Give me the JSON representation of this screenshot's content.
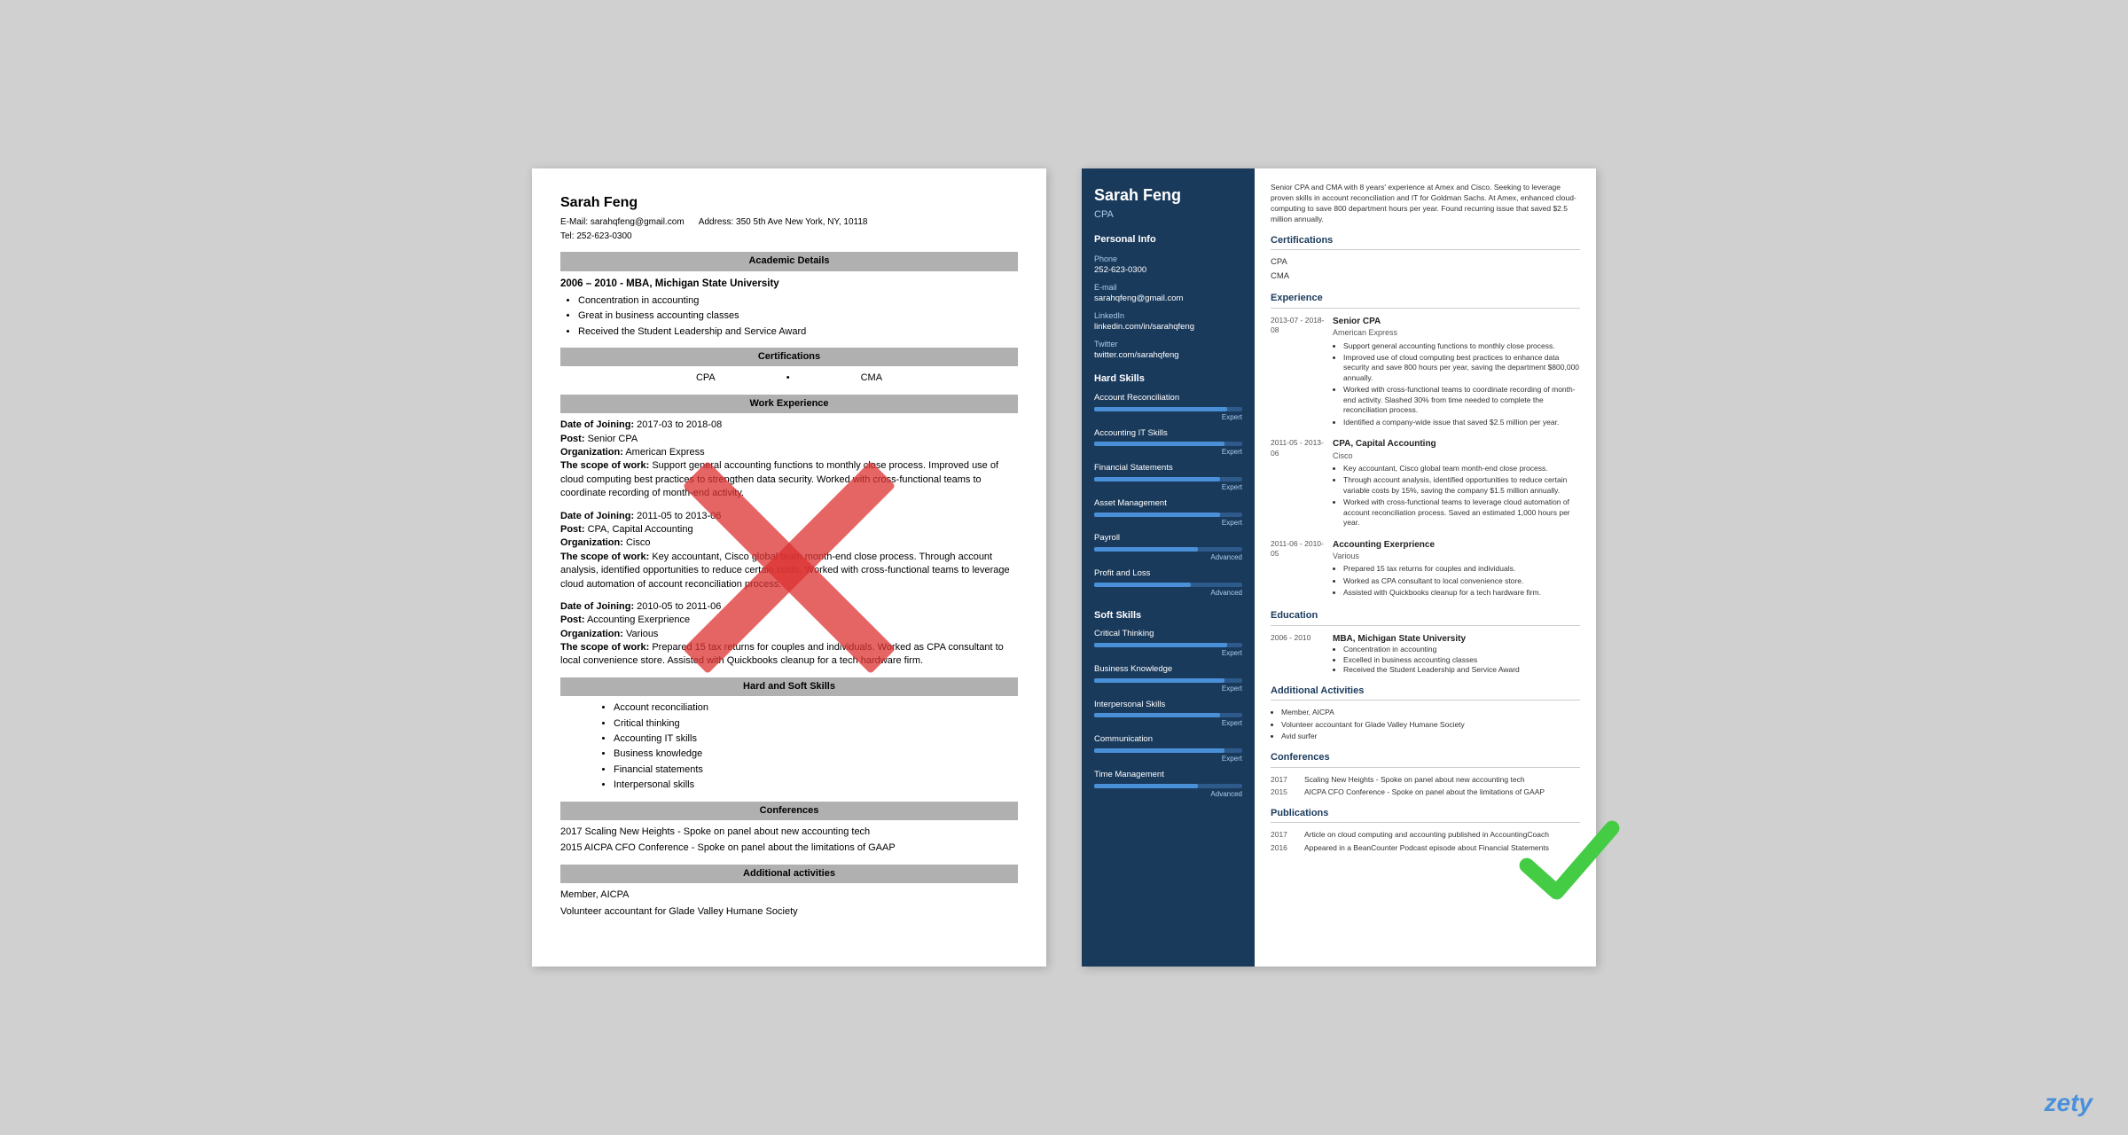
{
  "left_resume": {
    "name": "Sarah Feng",
    "email_label": "E-Mail:",
    "email": "sarahqfeng@gmail.com",
    "address_label": "Address:",
    "address": "350 5th Ave New York, NY, 10118",
    "tel_label": "Tel:",
    "tel": "252-623-0300",
    "sections": {
      "academic": "Academic Details",
      "certifications": "Certifications",
      "work_experience": "Work Experience",
      "hard_soft_skills": "Hard and Soft Skills",
      "conferences": "Conferences",
      "additional": "Additional activities"
    },
    "academic": {
      "dates": "2006 – 2010 - MBA, Michigan State University",
      "bullets": [
        "Concentration in accounting",
        "Great in business accounting classes",
        "Received the Student Leadership and Service Award"
      ]
    },
    "certifications": [
      "CPA",
      "CMA"
    ],
    "work_entries": [
      {
        "date_label": "Date of Joining:",
        "dates": "2017-03 to 2018-08",
        "post_label": "Post:",
        "post": "Senior CPA",
        "org_label": "Organization:",
        "org": "American Express",
        "scope_label": "The scope of work:",
        "scope": "Support general accounting functions to monthly close process. Improved use of cloud computing best practices to strengthen data security. Worked with cross-functional teams to coordinate recording of month-end activity."
      },
      {
        "date_label": "Date of Joining:",
        "dates": "2011-05 to 2013-06",
        "post_label": "Post:",
        "post": "CPA, Capital Accounting",
        "org_label": "Organization:",
        "org": "Cisco",
        "scope_label": "The scope of work:",
        "scope": "Key accountant, Cisco global team month-end close process. Through account analysis, identified opportunities to reduce certain costs. Worked with cross-functional teams to leverage cloud automation of account reconciliation process."
      },
      {
        "date_label": "Date of Joining:",
        "dates": "2010-05 to 2011-06",
        "post_label": "Post:",
        "post": "Accounting Exerprience",
        "org_label": "Organization:",
        "org": "Various",
        "scope_label": "The scope of work:",
        "scope": "Prepared 15 tax returns for couples and individuals. Worked as CPA consultant to local convenience store. Assisted with Quickbooks cleanup for a tech hardware firm."
      }
    ],
    "skills": [
      "Account reconciliation",
      "Critical thinking",
      "Accounting IT skills",
      "Business knowledge",
      "Financial statements",
      "Interpersonal skills"
    ],
    "conferences": [
      "2017 Scaling New Heights - Spoke on panel about new accounting tech",
      "2015 AICPA CFO Conference - Spoke on panel about the limitations of GAAP"
    ],
    "additional": [
      "Member, AICPA",
      "Volunteer accountant for Glade Valley Humane Society"
    ]
  },
  "right_resume": {
    "name": "Sarah Feng",
    "title": "CPA",
    "summary": "Senior CPA and CMA with 8 years' experience at Amex and Cisco. Seeking to leverage proven skills in account reconciliation and IT for Goldman Sachs. At Amex, enhanced cloud-computing to save 800 department hours per year. Found recurring issue that saved $2.5 million annually.",
    "personal_info": {
      "section_title": "Personal Info",
      "phone_label": "Phone",
      "phone": "252-623-0300",
      "email_label": "E-mail",
      "email": "sarahqfeng@gmail.com",
      "linkedin_label": "LinkedIn",
      "linkedin": "linkedin.com/in/sarahqfeng",
      "twitter_label": "Twitter",
      "twitter": "twitter.com/sarahqfeng"
    },
    "hard_skills": {
      "section_title": "Hard Skills",
      "items": [
        {
          "name": "Account Reconciliation",
          "level": "Expert",
          "pct": 90
        },
        {
          "name": "Accounting IT Skills",
          "level": "Expert",
          "pct": 88
        },
        {
          "name": "Financial Statements",
          "level": "Expert",
          "pct": 85
        },
        {
          "name": "Asset Management",
          "level": "Expert",
          "pct": 85
        },
        {
          "name": "Payroll",
          "level": "Advanced",
          "pct": 70
        },
        {
          "name": "Profit and Loss",
          "level": "Advanced",
          "pct": 65
        }
      ]
    },
    "soft_skills": {
      "section_title": "Soft Skills",
      "items": [
        {
          "name": "Critical Thinking",
          "level": "Expert",
          "pct": 90
        },
        {
          "name": "Business Knowledge",
          "level": "Expert",
          "pct": 88
        },
        {
          "name": "Interpersonal Skills",
          "level": "Expert",
          "pct": 85
        },
        {
          "name": "Communication",
          "level": "Expert",
          "pct": 88
        },
        {
          "name": "Time Management",
          "level": "Advanced",
          "pct": 70
        }
      ]
    },
    "certifications": {
      "section_title": "Certifications",
      "items": [
        "CPA",
        "CMA"
      ]
    },
    "experience": {
      "section_title": "Experience",
      "entries": [
        {
          "dates": "2013-07 - 2018-08",
          "title": "Senior CPA",
          "company": "American Express",
          "bullets": [
            "Support general accounting functions to monthly close process.",
            "Improved use of cloud computing best practices to enhance data security and save 800 hours per year, saving the department $800,000 annually.",
            "Worked with cross-functional teams to coordinate recording of month-end activity. Slashed 30% from time needed to complete the reconciliation process.",
            "Identified a company-wide issue that saved $2.5 million per year."
          ]
        },
        {
          "dates": "2011-05 - 2013-06",
          "title": "CPA, Capital Accounting",
          "company": "Cisco",
          "bullets": [
            "Key accountant, Cisco global team month-end close process.",
            "Through account analysis, identified opportunities to reduce certain variable costs by 15%, saving the company $1.5 million annually.",
            "Worked with cross-functional teams to leverage cloud automation of account reconciliation process. Saved an estimated 1,000 hours per year."
          ]
        },
        {
          "dates": "2011-06 - 2010-05",
          "title": "Accounting Exerprience",
          "company": "Various",
          "bullets": [
            "Prepared 15 tax returns for couples and individuals.",
            "Worked as CPA consultant to local convenience store.",
            "Assisted with Quickbooks cleanup for a tech hardware firm."
          ]
        }
      ]
    },
    "education": {
      "section_title": "Education",
      "entries": [
        {
          "dates": "2006 - 2010",
          "school": "MBA, Michigan State University",
          "bullets": [
            "Concentration in accounting",
            "Excelled in business accounting classes",
            "Received the Student Leadership and Service Award"
          ]
        }
      ]
    },
    "additional_activities": {
      "section_title": "Additional Activities",
      "bullets": [
        "Member, AICPA",
        "Volunteer accountant for Glade Valley Humane Society",
        "Avid surfer"
      ]
    },
    "conferences": {
      "section_title": "Conferences",
      "items": [
        {
          "year": "2017",
          "text": "Scaling New Heights - Spoke on panel about new accounting tech"
        },
        {
          "year": "2015",
          "text": "AICPA CFO Conference - Spoke on panel about the limitations of GAAP"
        }
      ]
    },
    "publications": {
      "section_title": "Publications",
      "items": [
        {
          "year": "2017",
          "text": "Article on cloud computing and accounting published in AccountingCoach"
        },
        {
          "year": "2016",
          "text": "Appeared in a BeanCounter Podcast episode about Financial Statements"
        }
      ]
    }
  },
  "watermark": "zety"
}
